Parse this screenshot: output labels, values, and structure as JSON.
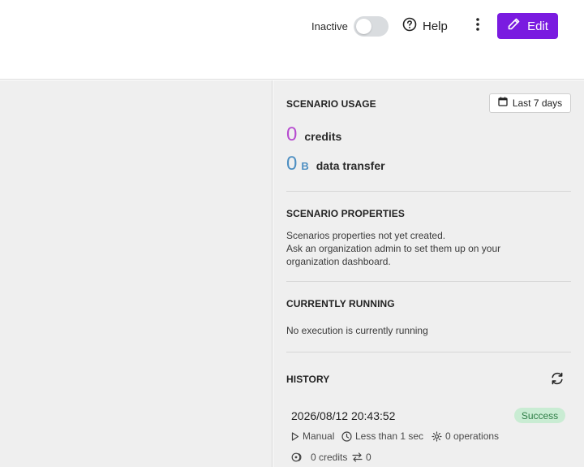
{
  "header": {
    "status_label": "Inactive",
    "help_label": "Help",
    "edit_label": "Edit",
    "edit_color": "#7a1be0"
  },
  "usage": {
    "title": "SCENARIO USAGE",
    "range_label": "Last 7 days",
    "credits_value": "0",
    "credits_label": "credits",
    "credits_color": "#b64bd0",
    "transfer_value": "0",
    "transfer_unit": "B",
    "transfer_label": "data transfer",
    "transfer_color": "#4d8fc2"
  },
  "properties": {
    "title": "SCENARIO PROPERTIES",
    "line1": "Scenarios properties not yet created.",
    "line2": "Ask an organization admin to set them up on your",
    "line3": "organization dashboard."
  },
  "running": {
    "title": "CURRENTLY RUNNING",
    "text": "No execution is currently running"
  },
  "history": {
    "title": "HISTORY",
    "items": [
      {
        "timestamp": "2026/08/12 20:43:52",
        "status": "Success",
        "trigger": "Manual",
        "duration": "Less than 1 sec",
        "operations": "0 operations",
        "credits": "0 credits",
        "transfer": "0"
      }
    ]
  },
  "icons": [
    "toggle-switch",
    "help-circle-icon",
    "kebab-menu-icon",
    "pencil-icon",
    "calendar-icon",
    "refresh-icon",
    "play-icon",
    "clock-icon",
    "gear-icon",
    "coins-icon",
    "transfer-arrows-icon"
  ]
}
